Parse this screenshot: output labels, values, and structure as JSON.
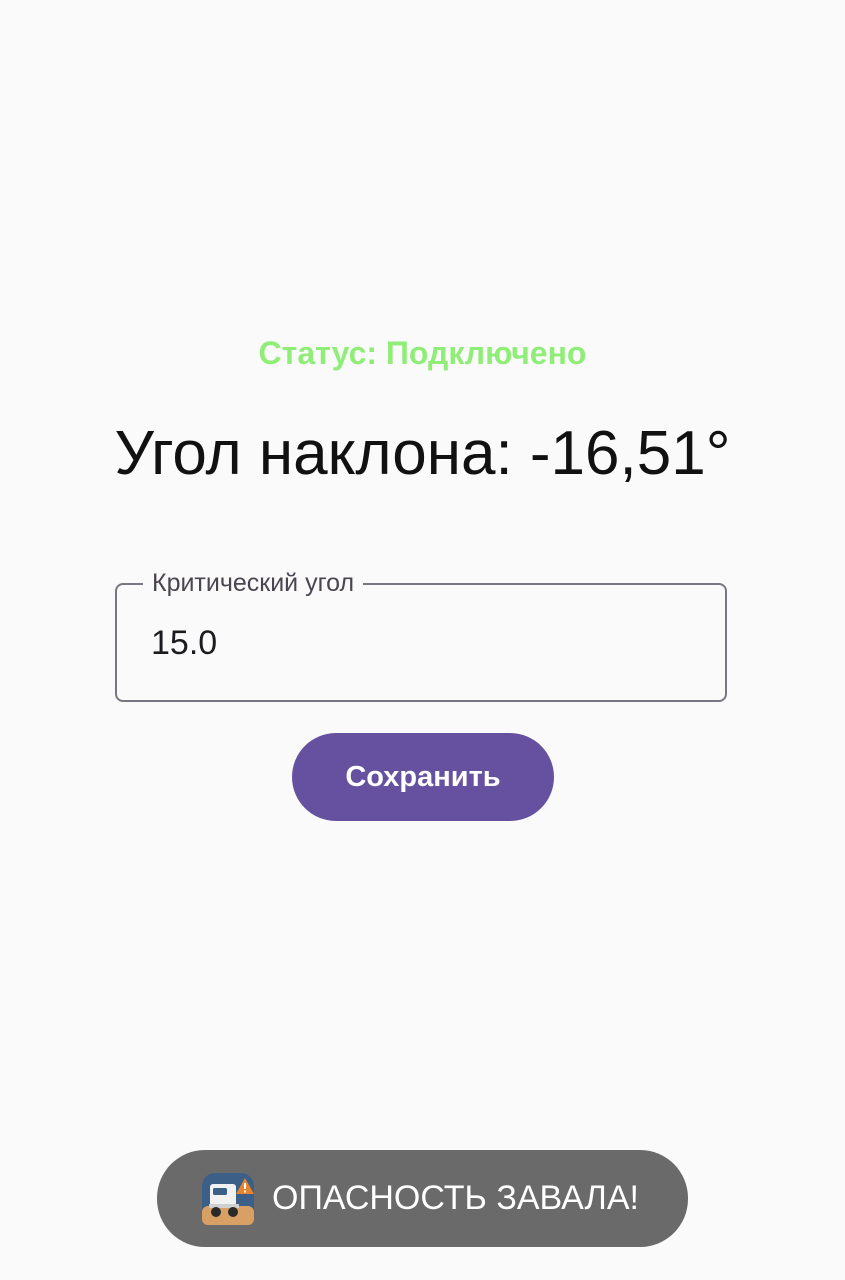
{
  "status": {
    "text": "Статус: Подключено",
    "color": "#90ee78"
  },
  "angle": {
    "text": "Угол наклона: -16,51°"
  },
  "critical_angle_field": {
    "label": "Критический угол",
    "value": "15.0"
  },
  "save_button": {
    "label": "Сохранить",
    "color": "#65519f"
  },
  "toast": {
    "icon": "app-icon-truck-warning",
    "text": "ОПАСНОСТЬ ЗАВАЛА!"
  }
}
